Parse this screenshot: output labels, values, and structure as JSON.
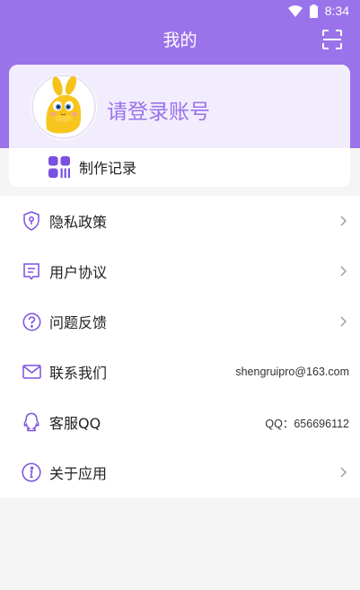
{
  "status_bar": {
    "time": "8:34"
  },
  "header": {
    "title": "我的"
  },
  "profile": {
    "login_prompt": "请登录账号",
    "records_label": "制作记录"
  },
  "menu": {
    "items": [
      {
        "label": "隐私政策",
        "icon": "shield-icon",
        "value": "",
        "has_chevron": true
      },
      {
        "label": "用户协议",
        "icon": "document-icon",
        "value": "",
        "has_chevron": true
      },
      {
        "label": "问题反馈",
        "icon": "question-icon",
        "value": "",
        "has_chevron": true
      },
      {
        "label": "联系我们",
        "icon": "mail-icon",
        "value": "shengruipro@163.com",
        "has_chevron": false
      },
      {
        "label": "客服QQ",
        "icon": "qq-icon",
        "value": "QQ：656696112",
        "has_chevron": false
      },
      {
        "label": "关于应用",
        "icon": "info-icon",
        "value": "",
        "has_chevron": true
      }
    ]
  },
  "colors": {
    "accent": "#9a72ea",
    "profile_bg": "#f2edfd",
    "page_bg": "#f5f5f5"
  }
}
